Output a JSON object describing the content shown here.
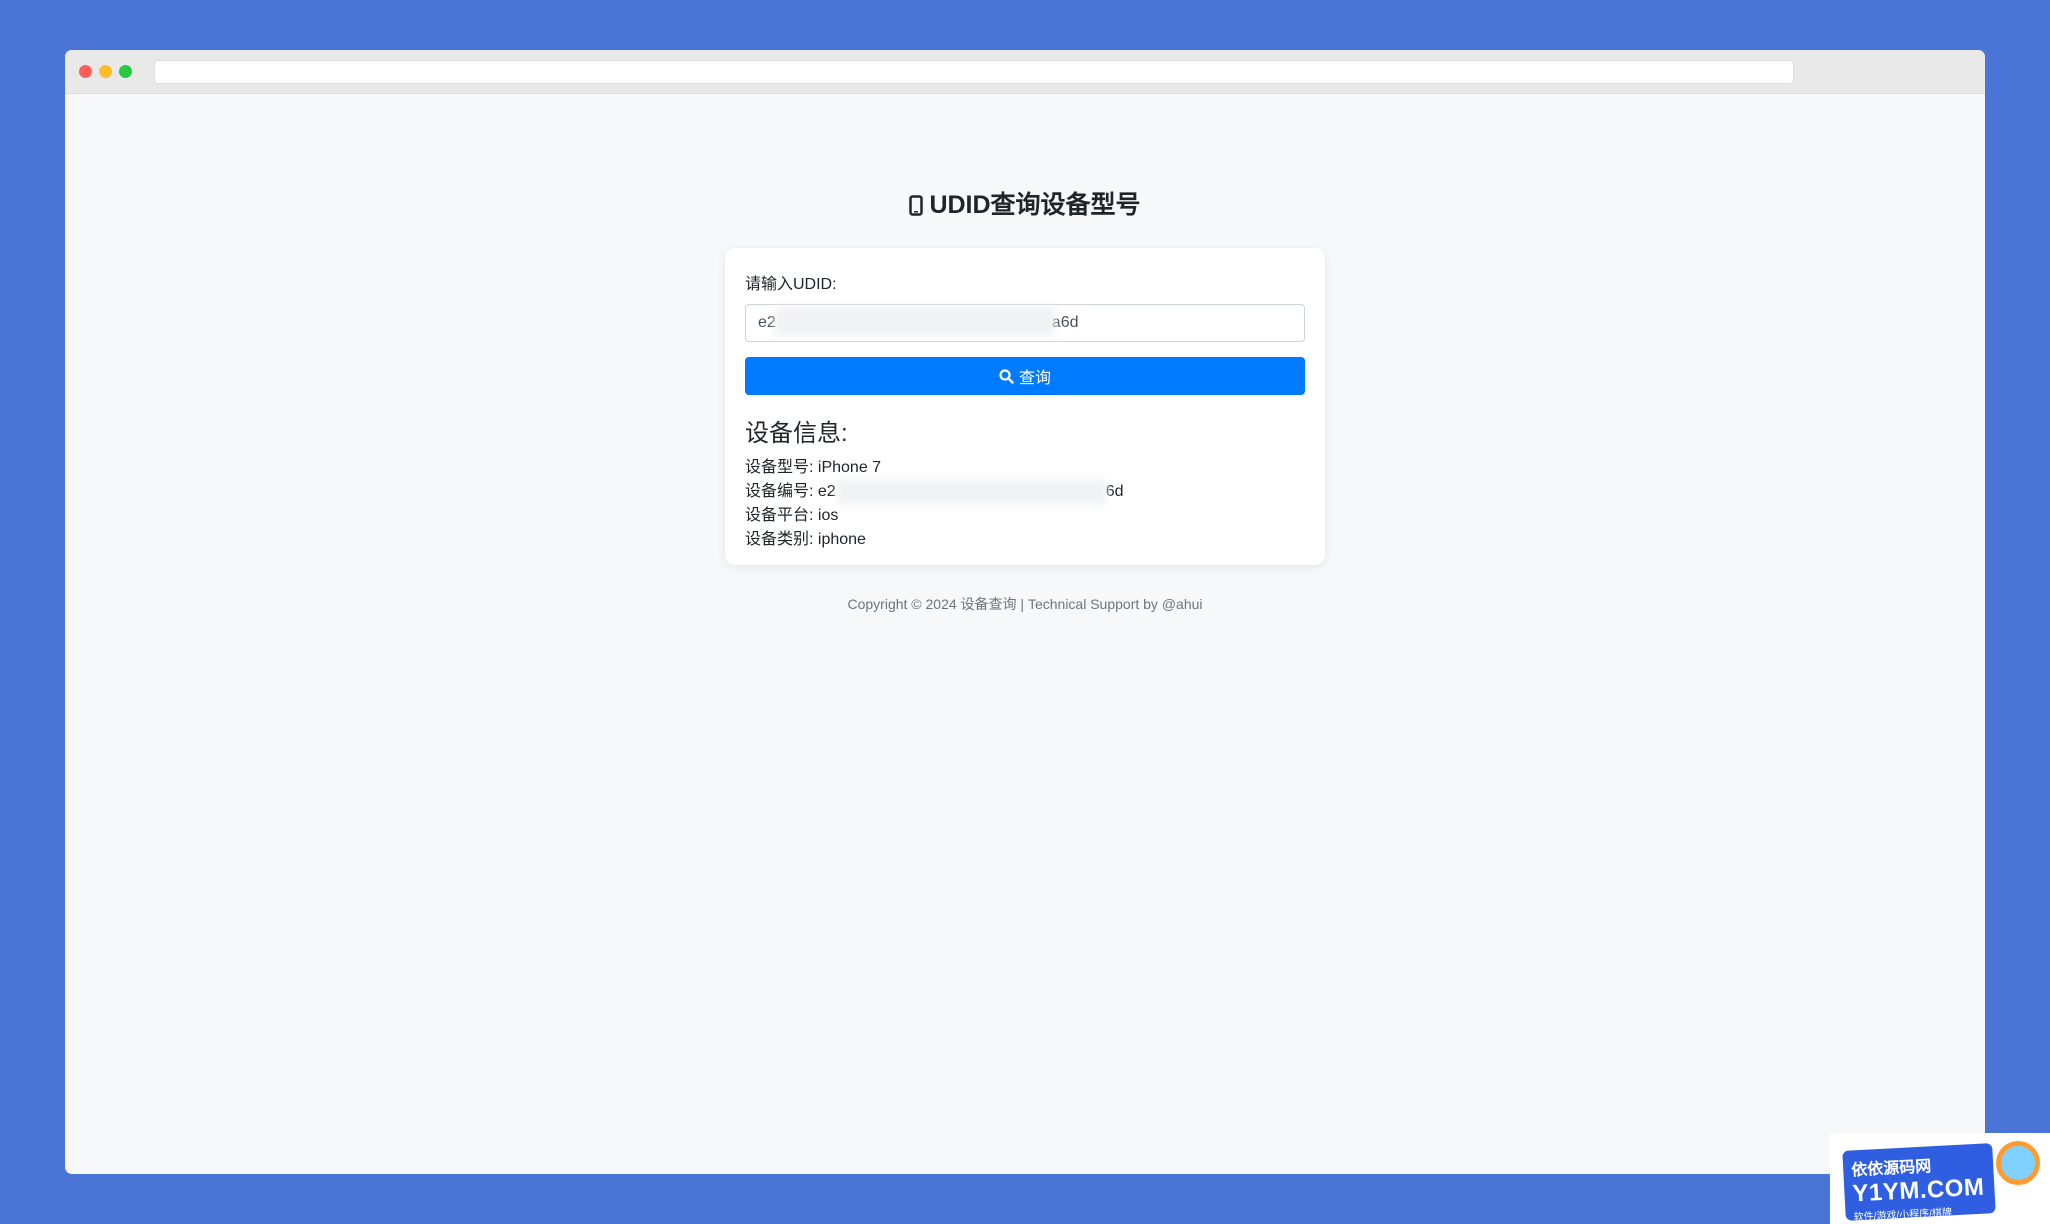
{
  "page": {
    "title": "UDID查询设备型号",
    "title_icon": "mobile-phone-icon"
  },
  "form": {
    "label": "请输入UDID:",
    "input_value_start": "e2",
    "input_value_end": "a6d",
    "button_label": "查询",
    "button_icon": "search-icon"
  },
  "device_info": {
    "heading": "设备信息:",
    "rows": [
      {
        "label": "设备型号:",
        "value": "iPhone 7"
      },
      {
        "label": "设备编号:",
        "value_start": "e2",
        "value_end": "6d"
      },
      {
        "label": "设备平台:",
        "value": "ios"
      },
      {
        "label": "设备类别:",
        "value": "iphone"
      }
    ]
  },
  "footer": {
    "text": "Copyright © 2024 设备查询 | Technical Support by @ahui"
  },
  "watermark": {
    "line1": "依依源码网",
    "line2": "Y1YM.COM",
    "line3": "软件/游戏/小程序/棋牌"
  },
  "colors": {
    "background": "#4a74d6",
    "primary_button": "#007bff",
    "page": "#f7f8fa"
  }
}
